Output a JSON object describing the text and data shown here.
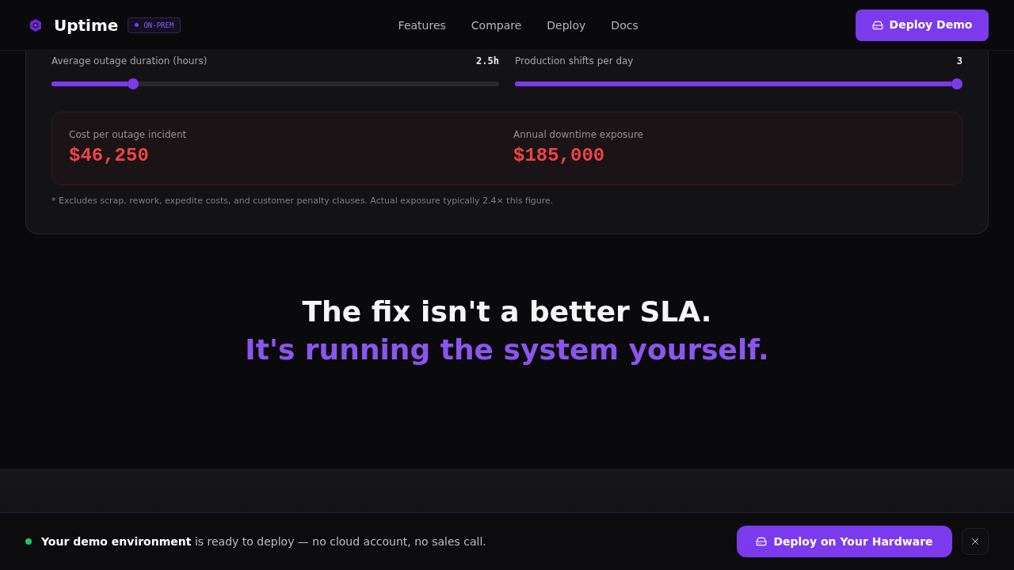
{
  "header": {
    "brand": "Uptime",
    "badge": "ON-PREM",
    "nav": [
      "Features",
      "Compare",
      "Deploy",
      "Docs"
    ],
    "cta": "Deploy Demo"
  },
  "calculator": {
    "sliders": [
      {
        "label": "Average outage duration (hours)",
        "reading": "2.5h",
        "level": 0.175
      },
      {
        "label": "Production shifts per day",
        "reading": "3",
        "level": 1
      }
    ],
    "results": [
      {
        "label": "Cost per outage incident",
        "value": "$46,250"
      },
      {
        "label": "Annual downtime exposure",
        "value": "$185,000"
      }
    ],
    "footnote": "* Excludes scrap, rework, expedite costs, and customer penalty clauses. Actual exposure typically 2.4× this figure."
  },
  "headline": {
    "line_1": "The fix isn't a better SLA.",
    "line_2": "It's running the system yourself."
  },
  "banner": {
    "message": "**Your demo environment** is ready to deploy — no cloud account, no sales call.",
    "cta": "Deploy on Your Hardware"
  }
}
